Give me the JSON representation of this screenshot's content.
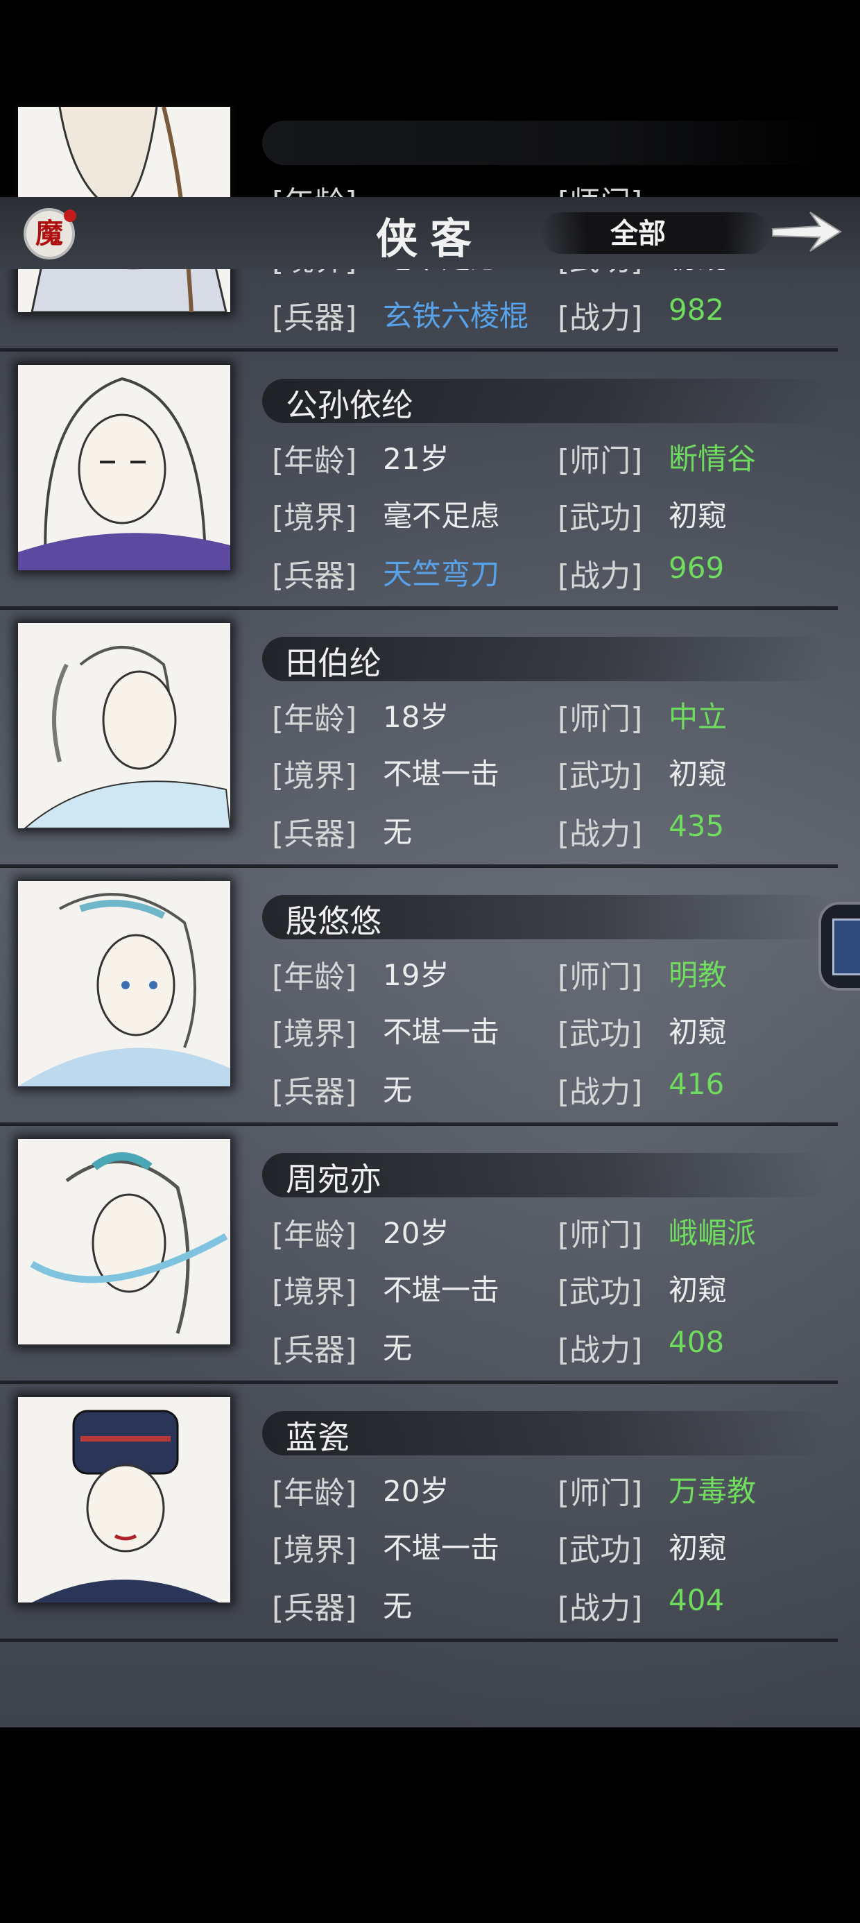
{
  "header": {
    "logo_glyph": "魔",
    "title": "侠客",
    "filter_label": "全部",
    "next_icon": "arrow-right-icon"
  },
  "labels": {
    "age": "[年龄]",
    "sect": "[师门]",
    "realm": "[境界]",
    "martial": "[武功]",
    "weapon": "[兵器]",
    "power": "[战力]"
  },
  "colors": {
    "sect_green": "#6fdc5f",
    "weapon_blue": "#58a2ea",
    "power_green": "#6fdc5f",
    "logo_red": "#b01010"
  },
  "heroes": [
    {
      "name": "",
      "age": "",
      "sect": "",
      "realm": "毫不足虑",
      "martial": "初窥",
      "weapon": "玄铁六棱棍",
      "weapon_color": "blue",
      "power": "982"
    },
    {
      "name": "公孙依纶",
      "age": "21岁",
      "sect": "断情谷",
      "realm": "毫不足虑",
      "martial": "初窥",
      "weapon": "天竺弯刀",
      "weapon_color": "blue",
      "power": "969"
    },
    {
      "name": "田伯纶",
      "age": "18岁",
      "sect": "中立",
      "realm": "不堪一击",
      "martial": "初窥",
      "weapon": "无",
      "weapon_color": "white",
      "power": "435"
    },
    {
      "name": "殷悠悠",
      "age": "19岁",
      "sect": "明教",
      "realm": "不堪一击",
      "martial": "初窥",
      "weapon": "无",
      "weapon_color": "white",
      "power": "416"
    },
    {
      "name": "周宛亦",
      "age": "20岁",
      "sect": "峨嵋派",
      "realm": "不堪一击",
      "martial": "初窥",
      "weapon": "无",
      "weapon_color": "white",
      "power": "408"
    },
    {
      "name": "蓝瓷",
      "age": "20岁",
      "sect": "万毒教",
      "realm": "不堪一击",
      "martial": "初窥",
      "weapon": "无",
      "weapon_color": "white",
      "power": "404"
    }
  ]
}
